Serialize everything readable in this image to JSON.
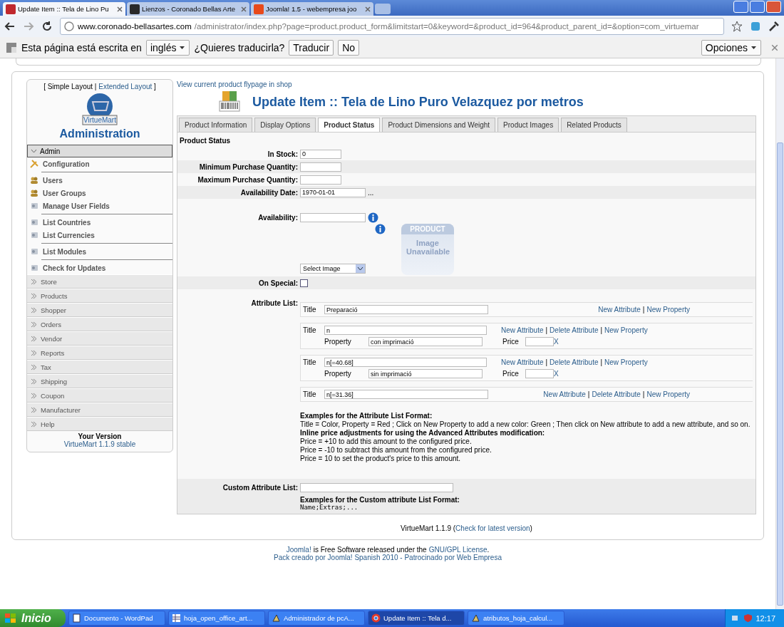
{
  "browser": {
    "tabs": [
      {
        "title": "Update Item :: Tela de Lino Pu",
        "selected": true
      },
      {
        "title": "Lienzos - Coronado Bellas Arte",
        "selected": false
      },
      {
        "title": "Joomla! 1.5 - webempresa joo",
        "selected": false
      }
    ],
    "url_host": "www.coronado-bellasartes.com",
    "url_path": "/administrator/index.php?page=product.product_form&limitstart=0&keyword=&product_id=964&product_parent_id=&option=com_virtuemar"
  },
  "translate_bar": {
    "text": "Esta página está escrita en",
    "language": "inglés",
    "question": "¿Quieres traducirla?",
    "buttons": [
      "Traducir",
      "No"
    ],
    "options": "Opciones"
  },
  "sidebar": {
    "layout_open": "[ Simple Layout |",
    "layout_link": "Extended Layout",
    "layout_close": "]",
    "logo_text": "VirtueMart",
    "heading": "Administration",
    "admin": {
      "label": "Admin",
      "expanded": true
    },
    "admin_items": [
      {
        "label": "Configuration",
        "kind": "config",
        "divider_after": true
      },
      {
        "label": "Users",
        "kind": "users",
        "divider_after": false
      },
      {
        "label": "User Groups",
        "kind": "users",
        "divider_after": false
      },
      {
        "label": "Manage User Fields",
        "kind": "tool",
        "divider_after": true
      },
      {
        "label": "List Countries",
        "kind": "tool",
        "divider_after": false
      },
      {
        "label": "List Currencies",
        "kind": "tool",
        "divider_after": true
      },
      {
        "label": "List Modules",
        "kind": "tool",
        "divider_after": true
      },
      {
        "label": "Check for Updates",
        "kind": "tool",
        "divider_after": false
      }
    ],
    "sections": [
      {
        "label": "Store",
        "expanded": false
      },
      {
        "label": "Products",
        "expanded": false
      },
      {
        "label": "Shopper",
        "expanded": false
      },
      {
        "label": "Orders",
        "expanded": false
      },
      {
        "label": "Vendor",
        "expanded": false
      },
      {
        "label": "Reports",
        "expanded": false
      },
      {
        "label": "Tax",
        "expanded": false
      },
      {
        "label": "Shipping",
        "expanded": false
      },
      {
        "label": "Coupon",
        "expanded": false
      },
      {
        "label": "Manufacturer",
        "expanded": false
      },
      {
        "label": "Help",
        "expanded": false
      }
    ],
    "version_label": "Your Version",
    "version": "VirtueMart 1.1.9 stable"
  },
  "main": {
    "flypage_link": "View current product flypage in shop",
    "title": "Update Item :: Tela de Lino Puro Velazquez por metros",
    "tabs": [
      {
        "label": "Product Information",
        "selected": false
      },
      {
        "label": "Display Options",
        "selected": false
      },
      {
        "label": "Product Status",
        "selected": true
      },
      {
        "label": "Product Dimensions and Weight",
        "selected": false
      },
      {
        "label": "Product Images",
        "selected": false
      },
      {
        "label": "Related Products",
        "selected": false
      }
    ],
    "section_title": "Product Status",
    "fields": [
      {
        "label": "In Stock:",
        "value": "0",
        "shaded": false,
        "wide": false
      },
      {
        "label": "Minimum Purchase Quantity:",
        "shaded": true,
        "wide": false
      },
      {
        "label": "Maximum Purchase Quantity:",
        "shaded": false,
        "wide": false
      },
      {
        "label": "Availability Date:",
        "value": "1970-01-01",
        "shaded": true,
        "wide": true,
        "picker": "..."
      }
    ],
    "availability_label": "Availability:",
    "image_select": "Select Image",
    "image_top": "PRODUCT",
    "image_text": "Image Unavailable",
    "special_label": "On Special:",
    "special_checked": false,
    "attribute_label": "Attribute List:",
    "attributes": [
      {
        "title_label": "Title",
        "title": "Preparació",
        "links": [
          "New Attribute",
          "New Property"
        ],
        "separator": "|"
      },
      {
        "title_label": "Title",
        "title": "n",
        "links": [
          "New Attribute",
          "Delete Attribute",
          "New Property"
        ],
        "separator": "|",
        "properties": [
          {
            "label": "Property",
            "value": "con imprimació",
            "price_label": "Price",
            "delete": "X"
          }
        ]
      },
      {
        "title_label": "Title",
        "title": "n[=40.68]",
        "links": [
          "New Attribute",
          "Delete Attribute",
          "New Property"
        ],
        "separator": "|",
        "properties": [
          {
            "label": "Property",
            "value": "sin imprimació",
            "price_label": "Price",
            "delete": "X"
          }
        ]
      },
      {
        "title_label": "Title",
        "title": "n[=31.36]",
        "links": [
          "New Attribute",
          "Delete Attribute",
          "New Property"
        ],
        "separator": "|"
      }
    ],
    "help": [
      {
        "text": "Examples for the Attribute List Format:",
        "bold": true
      },
      {
        "text": "Title = Color, Property = Red ; Click on New Property to add a new color: Green ; Then click on New attribute to add a new attribute, and so on.",
        "bold": false
      },
      {
        "text": "Inline price adjustments for using the Advanced Attributes modification:",
        "bold": true
      },
      {
        "text": "Price = +10 to add this amount to the configured price.",
        "bold": false
      },
      {
        "text": "Price = -10 to subtract this amount from the configured price.",
        "bold": false
      },
      {
        "text": "Price = 10 to set the product's price to this amount.",
        "bold": false
      }
    ],
    "custom_label": "Custom Attribute List:",
    "custom_help": "Examples for the Custom attribute List Format:",
    "custom_example": "Name;Extras;..."
  },
  "footer": {
    "version_text": "VirtueMart 1.1.9 (",
    "version_link": "Check for latest version",
    "version_close": ")",
    "joomla_link": "Joomla!",
    "joomla_text": "is Free Software released under the",
    "license_link": "GNU/GPL License",
    "period": ".",
    "pack_text": "Pack creado por Joomla! Spanish 2010 - Patrocinado por Web Empresa"
  },
  "taskbar": {
    "start": "Inicio",
    "items": [
      {
        "label": "Documento - WordPad",
        "kind": "doc",
        "selected": false
      },
      {
        "label": "hoja_open_office_art...",
        "kind": "sheet",
        "selected": false
      },
      {
        "label": "Administrador de pcA...",
        "kind": "tool",
        "selected": false
      },
      {
        "label": "Update Item :: Tela d...",
        "kind": "browser",
        "selected": true
      },
      {
        "label": "atributos_hoja_calcul...",
        "kind": "tool",
        "selected": false
      }
    ],
    "time": "12:17"
  }
}
